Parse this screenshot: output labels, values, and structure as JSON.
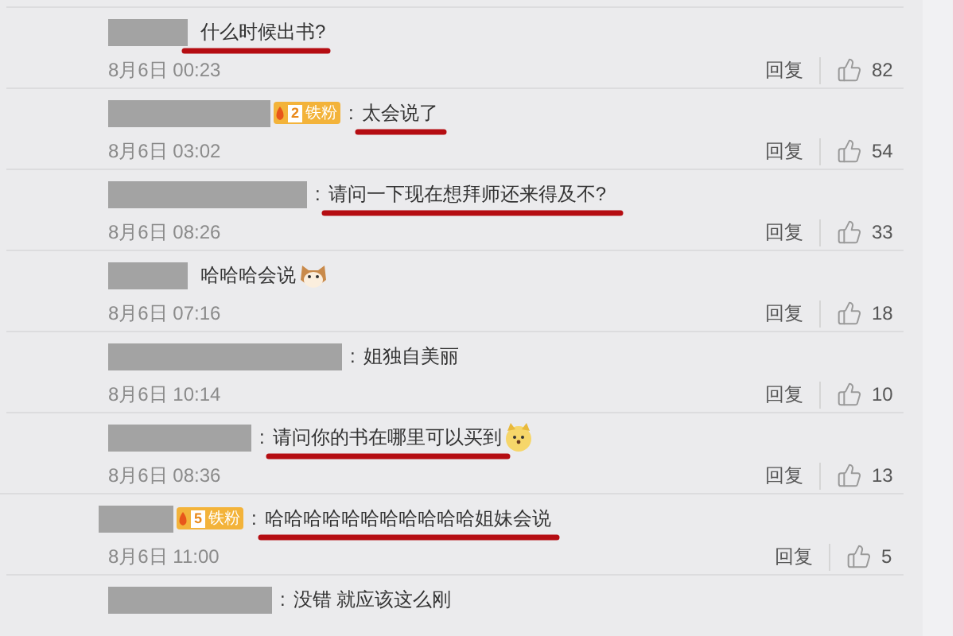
{
  "comments": [
    {
      "text": "什么时候出书?",
      "underlined": true,
      "time": "8月6日 00:23",
      "reply": "回复",
      "likes": "82"
    },
    {
      "badge": {
        "level": "2",
        "label": "铁粉"
      },
      "separator": ":",
      "text": "太会说了",
      "underlined": true,
      "time": "8月6日 03:02",
      "reply": "回复",
      "likes": "54"
    },
    {
      "separator": ":",
      "text": "请问一下现在想拜师还来得及不?",
      "underlined": true,
      "time": "8月6日 08:26",
      "reply": "回复",
      "likes": "33"
    },
    {
      "text": "哈哈哈会说",
      "underlined": false,
      "sticker": {
        "kind": "cat"
      },
      "time": "8月6日 07:16",
      "reply": "回复",
      "likes": "18"
    },
    {
      "separator": ":",
      "text": "姐独自美丽",
      "underlined": false,
      "time": "8月6日 10:14",
      "reply": "回复",
      "likes": "10"
    },
    {
      "separator": ":",
      "text": "请问你的书在哪里可以买到",
      "underlined": true,
      "sticker": {
        "kind": "dog"
      },
      "time": "8月6日 08:36",
      "reply": "回复",
      "likes": "13"
    },
    {
      "badge": {
        "level": "5",
        "label": "铁粉"
      },
      "separator": ":",
      "text": "哈哈哈哈哈哈哈哈哈哈哈姐妹会说",
      "underlined": true,
      "time": "8月6日 11:00",
      "reply": "回复",
      "likes": "5"
    },
    {
      "separator": ":",
      "text": "没错 就应该这么刚",
      "underlined": false
    }
  ]
}
